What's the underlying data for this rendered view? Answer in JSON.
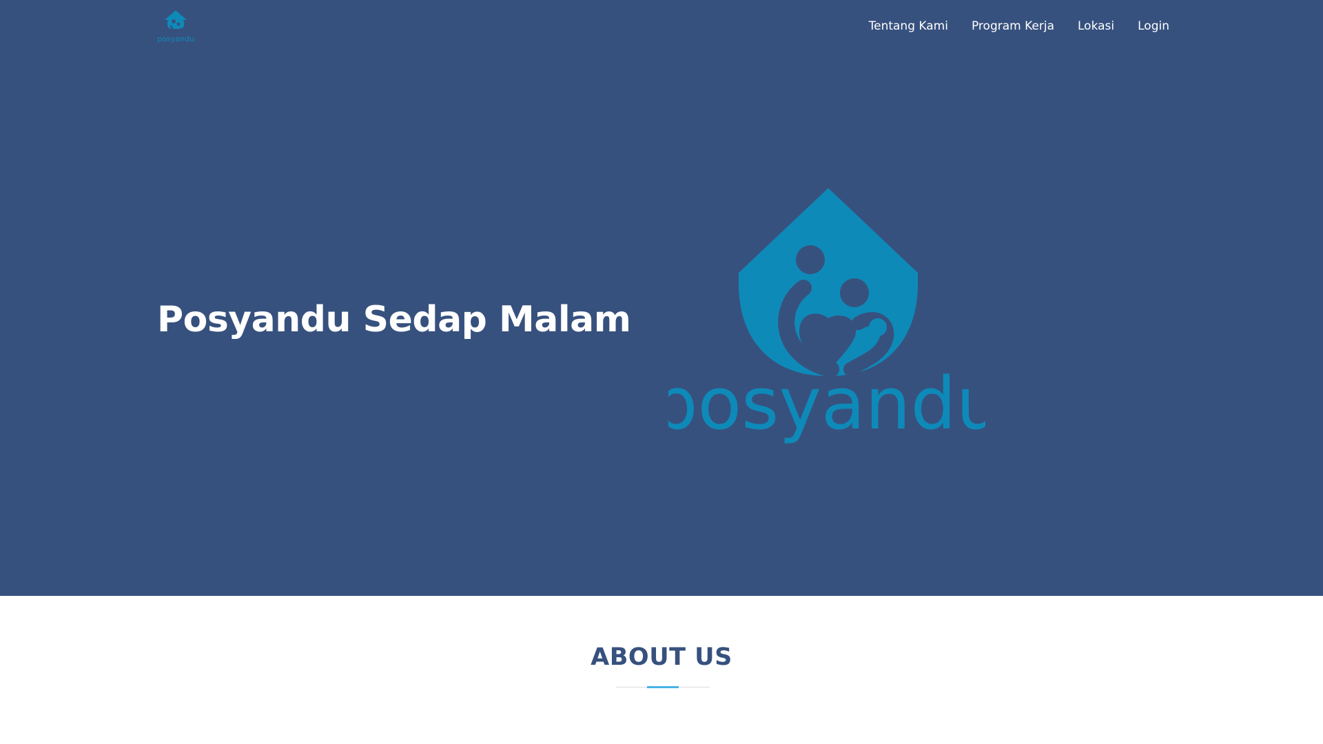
{
  "header": {
    "brand_text": "posyandu",
    "nav": [
      {
        "label": "Tentang Kami"
      },
      {
        "label": "Program Kerja"
      },
      {
        "label": "Lokasi"
      },
      {
        "label": "Login"
      }
    ]
  },
  "hero": {
    "title": "Posyandu Sedap Malam",
    "logo_text": "posyandu"
  },
  "about": {
    "title": "ABOUT US"
  },
  "colors": {
    "hero_bg": "#37517e",
    "brand_teal": "#0e8ab9",
    "accent": "#47b2e4",
    "about_title": "#37517e"
  },
  "icons": {
    "brand_logo": "posyandu-house-family-logo"
  }
}
